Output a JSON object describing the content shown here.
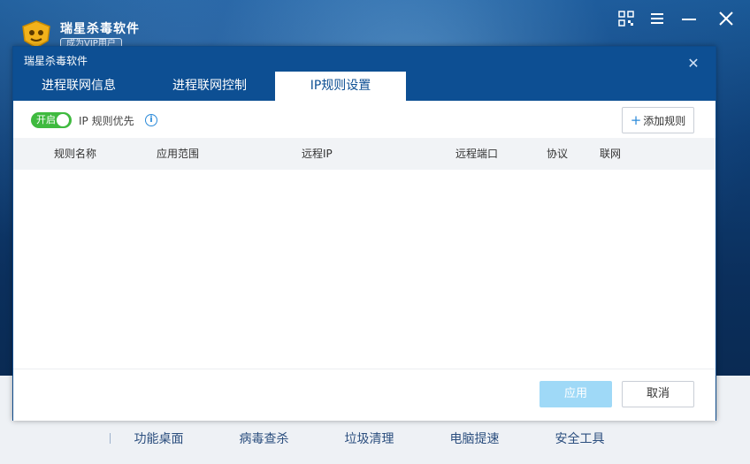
{
  "app": {
    "title": "瑞星杀毒软件",
    "vip_badge": "成为VIP用户",
    "window_controls": [
      "qr-code-icon",
      "menu-icon",
      "minimize-icon",
      "close-icon"
    ]
  },
  "bottom_nav": {
    "items": [
      {
        "label": "功能桌面"
      },
      {
        "label": "病毒查杀"
      },
      {
        "label": "垃圾清理"
      },
      {
        "label": "电脑提速"
      },
      {
        "label": "安全工具"
      }
    ]
  },
  "dialog": {
    "title": "瑞星杀毒软件",
    "tabs": [
      {
        "label": "进程联网信息",
        "active": false
      },
      {
        "label": "进程联网控制",
        "active": false
      },
      {
        "label": "IP规则设置",
        "active": true
      }
    ],
    "toggle": {
      "label": "开启",
      "on": true
    },
    "ip_priority_label": "IP 规则优先",
    "add_rule_label": "添加规则",
    "columns": [
      "规则名称",
      "应用范围",
      "远程IP",
      "远程端口",
      "协议",
      "联网"
    ],
    "rows": [],
    "apply_label": "应用",
    "apply_enabled": false,
    "cancel_label": "取消"
  },
  "colors": {
    "header_blue": "#0d4f93",
    "toggle_green": "#3fba3f",
    "apply_disabled": "#9fd9f7",
    "accent_blue": "#2b8ad9"
  }
}
